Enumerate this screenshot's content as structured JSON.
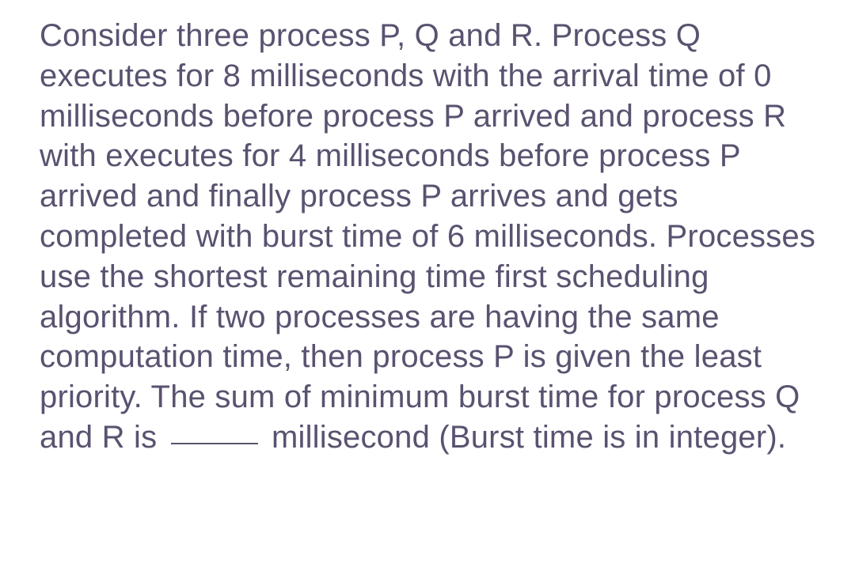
{
  "question": {
    "part1": "Consider three process P, Q and R. Process Q executes for 8 milliseconds with the arrival time of 0 milliseconds before process P arrived and process R with executes for 4 milliseconds before process P arrived and finally process P arrives and gets completed with burst time of 6 milliseconds. Processes use the shortest remaining time first scheduling algorithm. If two processes are having the same computation time, then process P is given the least priority. The sum of minimum burst time for process Q and R is ",
    "part2": " millisecond (Burst time is in integer)."
  }
}
